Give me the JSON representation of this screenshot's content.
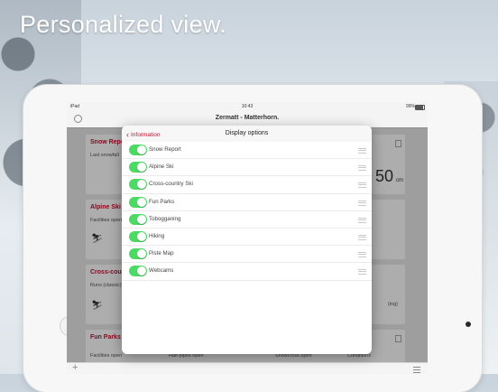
{
  "headline": "Personalized view.",
  "status_bar": {
    "carrier": "iPad",
    "time": "10:43",
    "battery": "99%"
  },
  "nav": {
    "title": "Zermatt - Matterhorn."
  },
  "popover": {
    "back_label": "Information",
    "title": "Display options",
    "options": [
      {
        "label": "Snow Report",
        "enabled": true
      },
      {
        "label": "Alpine Ski",
        "enabled": true
      },
      {
        "label": "Cross-country Ski",
        "enabled": true
      },
      {
        "label": "Fun Parks",
        "enabled": true
      },
      {
        "label": "Tobogganing",
        "enabled": true
      },
      {
        "label": "Hiking",
        "enabled": true
      },
      {
        "label": "Piste Map",
        "enabled": true
      },
      {
        "label": "Webcams",
        "enabled": true
      }
    ]
  },
  "background_cards": {
    "snow_report": {
      "title": "Snow Report",
      "subtitle": "Last snowfall",
      "value": "50",
      "unit": "cm"
    },
    "alpine_ski": {
      "title": "Alpine Ski",
      "subtitle": "Facilities open"
    },
    "cross_country": {
      "title": "Cross-country Ski",
      "subtitle": "Runs (classic)",
      "right_text": "(ing)"
    },
    "fun_parks": {
      "title": "Fun Parks",
      "subtitle": "Facilities open",
      "col2": "Half-pipes open",
      "col3": "Snowcross open",
      "col4": "Conditions"
    }
  },
  "accent_color": "#c8102e",
  "toggle_on_color": "#4cd964"
}
